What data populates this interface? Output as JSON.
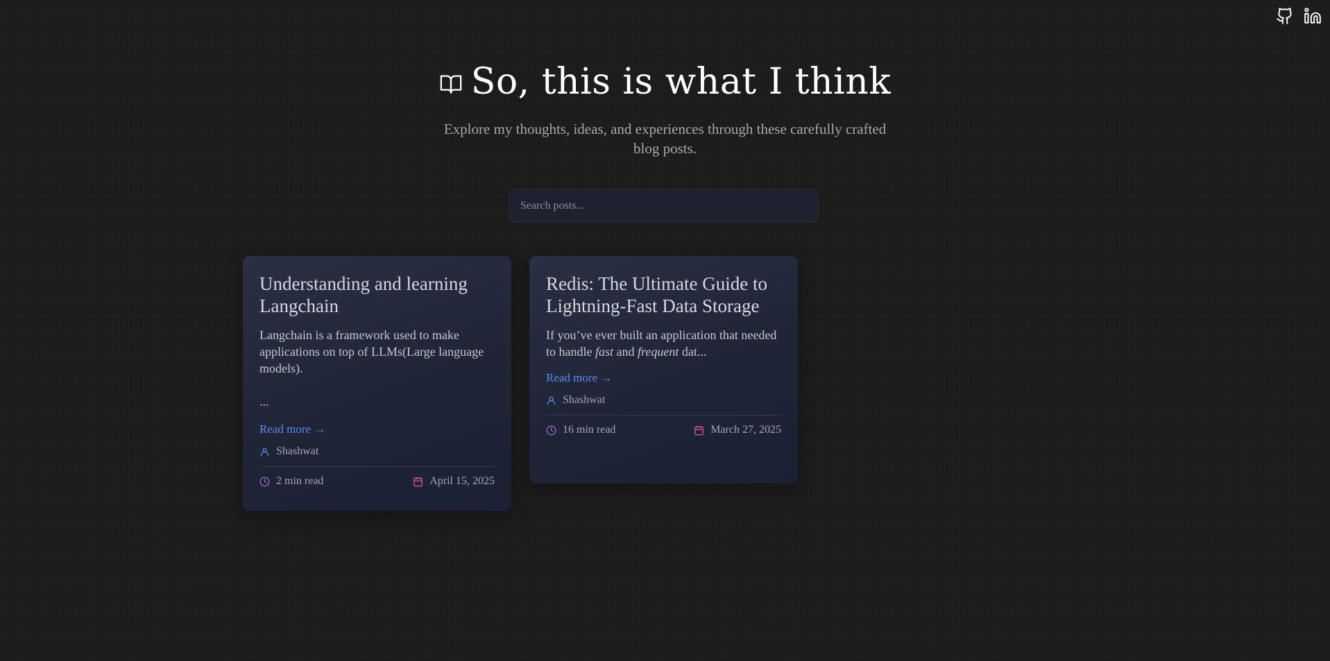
{
  "header": {
    "title": "So, this is what I think",
    "subtitle": "Explore my thoughts, ideas, and experiences through these carefully crafted blog posts.",
    "icons": [
      "book-open-icon",
      "github-icon",
      "linkedin-icon"
    ]
  },
  "search": {
    "placeholder": "Search posts...",
    "value": ""
  },
  "posts": [
    {
      "title": "Understanding and learning Langchain",
      "excerpt": "Langchain is a framework used to make applications on top of LLMs(Large language models).",
      "excerpt_tail": "...",
      "read_more": "Read more →",
      "author": "Shashwat",
      "read_time": "2 min read",
      "date": "April 15, 2025"
    },
    {
      "title": "Redis: The Ultimate Guide to Lightning-Fast Data Storage",
      "excerpt_parts": [
        "If you’ve ever built an application that needed to handle ",
        "fast",
        " and ",
        "frequent",
        " dat..."
      ],
      "read_more": "Read more →",
      "author": "Shashwat",
      "read_time": "16 min read",
      "date": "March 27, 2025"
    }
  ],
  "colors": {
    "background": "#1c1c1c",
    "card": "#232a3d",
    "link": "#5b8cf0",
    "author_icon": "#5b8cf0",
    "clock_icon": "#a36bdc",
    "calendar_icon": "#e0578f"
  }
}
